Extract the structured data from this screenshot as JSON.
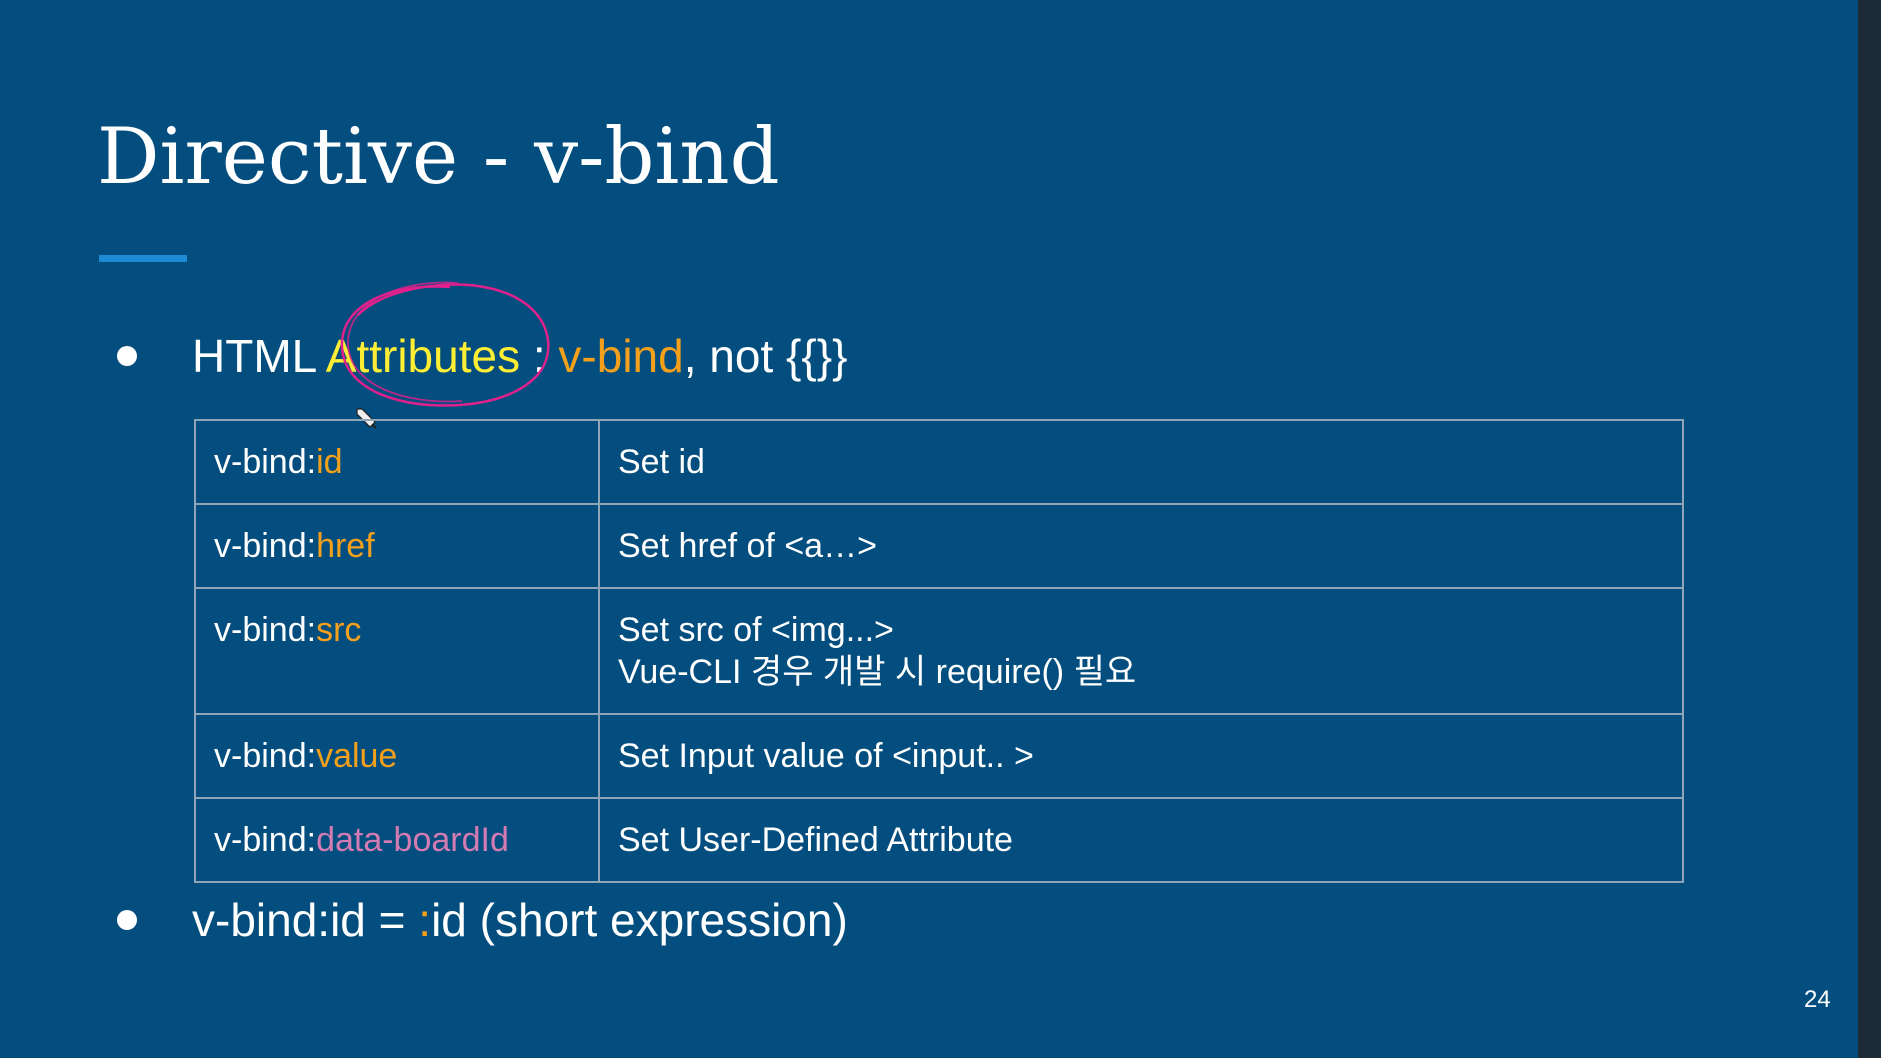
{
  "slide": {
    "title": "Directive - v-bind",
    "bullet1": {
      "prefix": "HTML ",
      "highlight": "Attributes",
      "separator": " : ",
      "vbind": "v-bind",
      "suffix": ", not {{}}"
    },
    "table": {
      "rows": [
        {
          "prefix": "v-bind:",
          "attr": "id",
          "attr_color": "orange",
          "desc": [
            "Set id"
          ]
        },
        {
          "prefix": "v-bind:",
          "attr": "href",
          "attr_color": "orange",
          "desc": [
            "Set href of <a…>"
          ]
        },
        {
          "prefix": "v-bind:",
          "attr": "src",
          "attr_color": "orange",
          "desc": [
            "Set src of <img...>",
            "Vue-CLI 경우 개발 시 require() 필요"
          ]
        },
        {
          "prefix": "v-bind:",
          "attr": "value",
          "attr_color": "orange",
          "desc": [
            "Set Input value of <input.. >"
          ]
        },
        {
          "prefix": "v-bind:",
          "attr": "data-boardId",
          "attr_color": "pink",
          "desc": [
            "Set User-Defined Attribute"
          ]
        }
      ]
    },
    "bullet2": {
      "prefix": "v-bind:id = ",
      "colon": ":",
      "suffix": "id (short expression)"
    },
    "page_number": "24"
  },
  "colors": {
    "background": "#034e7e",
    "accent_underline": "#1e8ad6",
    "yellow": "#ffee33",
    "orange": "#f5a01a",
    "pink": "#d57bb3",
    "annotation_circle": "#e0208c"
  },
  "icons": {
    "bullet": "bullet-dot-icon",
    "cursor": "pen-cursor-icon"
  }
}
